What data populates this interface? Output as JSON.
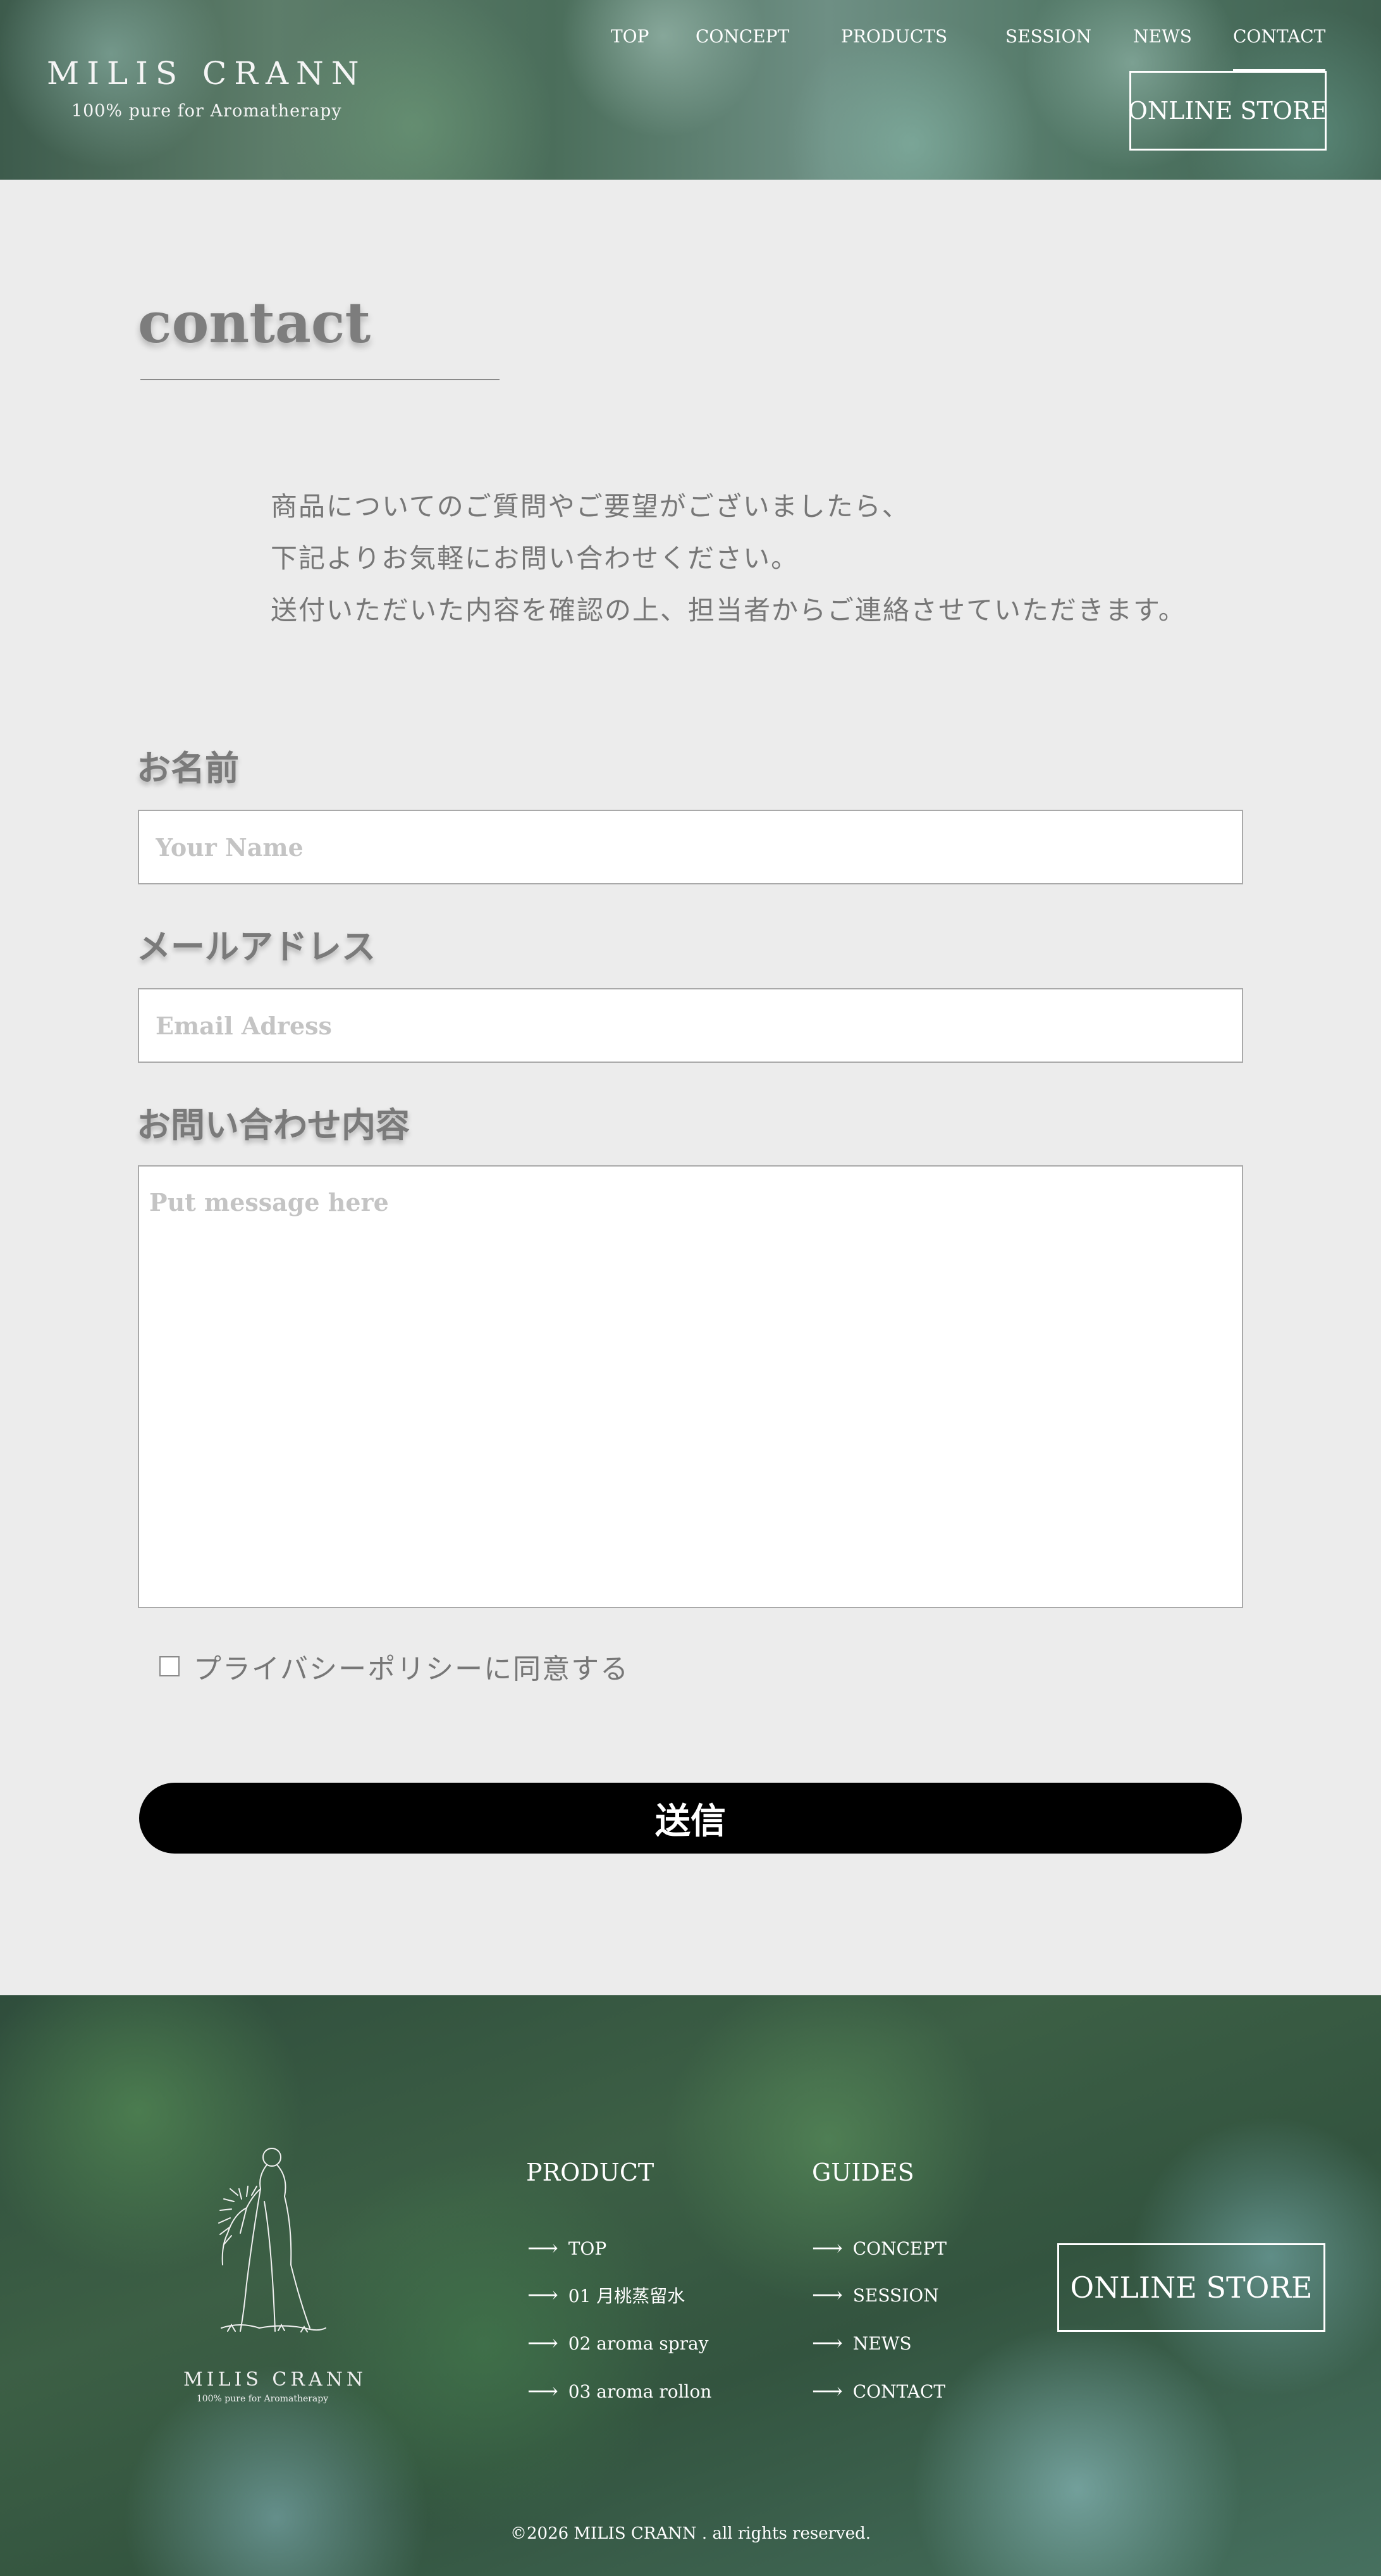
{
  "header": {
    "logo_title": "MILIS CRANN",
    "logo_subtitle": "100% pure for Aromatherapy",
    "nav": [
      "TOP",
      "CONCEPT",
      "PRODUCTS",
      "SESSION",
      "NEWS",
      "CONTACT"
    ],
    "active_nav": "CONTACT",
    "store_button": "ONLINE STORE"
  },
  "main": {
    "title": "contact",
    "intro": [
      "商品についてのご質問やご要望がございましたら、",
      "下記よりお気軽にお問い合わせください。",
      "送付いただいた内容を確認の上、担当者からご連絡させていただきます。"
    ]
  },
  "form": {
    "name_label": "お名前",
    "name_placeholder": "Your Name",
    "email_label": "メールアドレス",
    "email_placeholder": "Email Adress",
    "message_label": "お問い合わせ内容",
    "message_placeholder": "Put message here",
    "privacy_label": "プライバシーポリシーに同意する",
    "privacy_checked": false,
    "submit_label": "送信"
  },
  "footer": {
    "logo_title": "MILIS CRANN",
    "logo_subtitle": "100% pure for Aromatherapy",
    "product_heading": "PRODUCT",
    "product_links": [
      "TOP",
      "01 月桃蒸留水",
      "02 aroma spray",
      "03 aroma rollon"
    ],
    "guides_heading": "GUIDES",
    "guides_links": [
      "CONCEPT",
      "SESSION",
      "NEWS",
      "CONTACT"
    ],
    "store_button": "ONLINE STORE",
    "copyright": "©2026 MILIS CRANN . all rights reserved."
  },
  "colors": {
    "background": "#ececec",
    "submit_button": "#000000",
    "header_green": "#4b6e5b",
    "footer_green": "#33543f"
  }
}
